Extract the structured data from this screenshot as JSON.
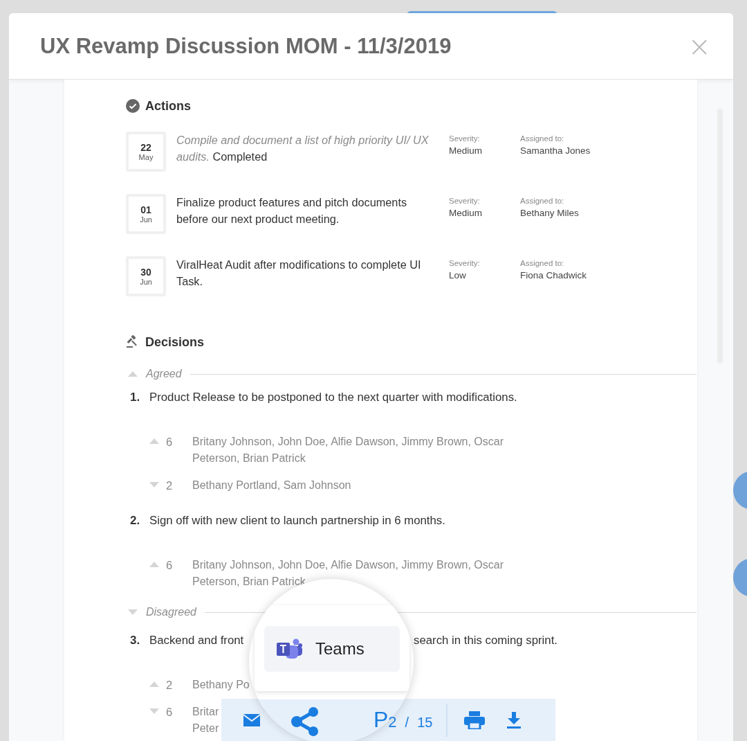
{
  "dialog": {
    "title": "UX Revamp Discussion MOM - 11/3/2019",
    "close": "×"
  },
  "actions": {
    "heading": "Actions",
    "items": [
      {
        "day": "22",
        "month": "May",
        "description": "Compile and document a list of high priority UI/ UX audits.",
        "completed": true,
        "status": "Completed",
        "severity_label": "Severity:",
        "severity": "Medium",
        "assigned_label": "Assigned to:",
        "assignee": "Samantha Jones"
      },
      {
        "day": "01",
        "month": "Jun",
        "description": "Finalize product features and pitch documents before our next product meeting.",
        "completed": false,
        "severity_label": "Severity:",
        "severity": "Medium",
        "assigned_label": "Assigned to:",
        "assignee": "Bethany Miles"
      },
      {
        "day": "30",
        "month": "Jun",
        "description": "ViralHeat Audit after modifications to complete UI Task.",
        "completed": false,
        "severity_label": "Severity:",
        "severity": "Low",
        "assigned_label": "Assigned to:",
        "assignee": "Fiona Chadwick"
      }
    ]
  },
  "decisions": {
    "heading": "Decisions",
    "groups": [
      {
        "kind": "agreed",
        "label": "Agreed",
        "items": [
          {
            "number": "1.",
            "text": "Product Release to be postponed to the next quarter with modifications.",
            "votes": [
              {
                "kind": "up",
                "count": "6",
                "lines": [
                  "Britany Johnson, John Doe, Alfie Dawson, Jimmy Brown, Oscar",
                  "Peterson, Brian Patrick"
                ]
              },
              {
                "kind": "down",
                "count": "2",
                "lines": [
                  "Bethany Portland, Sam Johnson"
                ]
              }
            ]
          },
          {
            "number": "2.",
            "text": "Sign off with new client to launch partnership in 6 months.",
            "votes": [
              {
                "kind": "up",
                "count": "6",
                "lines": [
                  "Britany Johnson, John Doe, Alfie Dawson, Jimmy Brown, Oscar",
                  "Peterson, Brian Patrick"
                ]
              }
            ]
          }
        ]
      },
      {
        "kind": "disagreed",
        "label": "Disagreed",
        "items": [
          {
            "number": "3.",
            "text": "Backend and front",
            "text_after": "search in this coming sprint.",
            "votes": [
              {
                "kind": "up",
                "count": "2",
                "lines": [
                  "Bethany Po"
                ]
              },
              {
                "kind": "down",
                "count": "6",
                "lines": [
                  "Britar",
                  "Peter"
                ]
              }
            ]
          }
        ]
      }
    ]
  },
  "share_menu": {
    "items": [
      {
        "label": "Teams"
      }
    ]
  },
  "toolbar": {
    "page_prefix": "P",
    "page": "2",
    "separator": "/",
    "total": "15"
  }
}
